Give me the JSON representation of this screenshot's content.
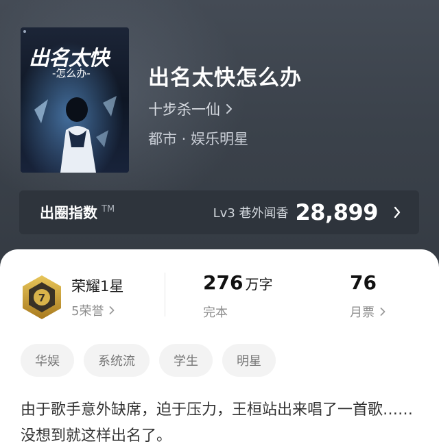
{
  "book": {
    "title": "出名太快怎么办",
    "cover_title": "出名太快",
    "cover_subtitle": "-怎么办-",
    "author": "十步杀一仙",
    "genre": "都市 · 娱乐明星"
  },
  "index_bar": {
    "label": "出圈指数",
    "tm": "TM",
    "level": "Lv3 巷外闻香",
    "value": "28,899"
  },
  "stats": {
    "honor_title": "荣耀1星",
    "honor_sub": "5荣誉",
    "words_num": "276",
    "words_unit": "万字",
    "words_sub": "完本",
    "tickets_num": "76",
    "tickets_sub": "月票"
  },
  "tags": [
    "华娱",
    "系统流",
    "学生",
    "明星"
  ],
  "intro": "由于歌手意外缺席，迫于压力，王桓站出来唱了一首歌……没想到就这样出名了。",
  "icons": {
    "author_chevron": "chevron-right-icon",
    "index_chevron": "chevron-right-icon",
    "honor_badge": "hexagon-badge-icon"
  },
  "colors": {
    "hero_bg": "#3b424b",
    "index_bar_bg": "#2e343c",
    "badge_gold": "#c9a23a",
    "tag_bg": "#f3f3f3"
  }
}
